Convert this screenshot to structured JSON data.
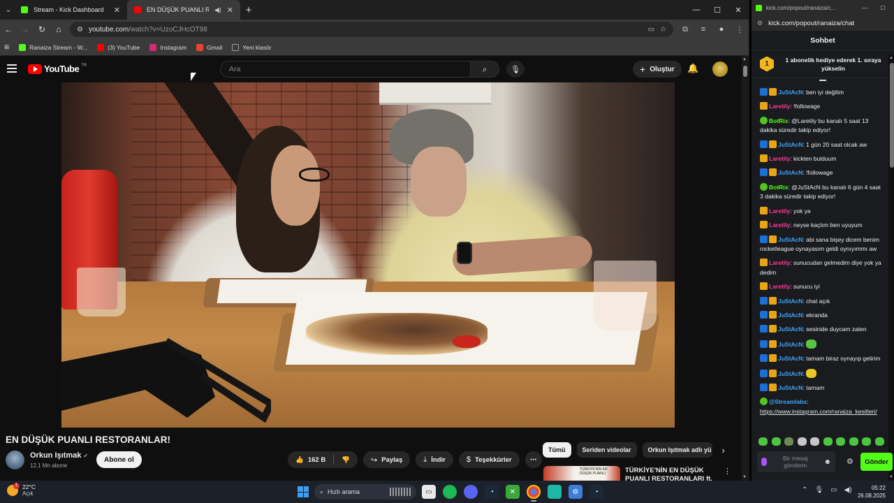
{
  "browser": {
    "tabs": [
      {
        "title": "Stream - Kick Dashboard",
        "favicon_color": "#53fc18"
      },
      {
        "title": "EN DÜŞÜK PUANLI RESTORAN",
        "favicon_color": "#ff0000"
      }
    ],
    "url_host": "youtube.com",
    "url_path": "/watch?v=UzoCJHcOT98",
    "bookmarks": [
      {
        "label": "Ranaiza Stream - W...",
        "color": "#53fc18"
      },
      {
        "label": "(3) YouTube",
        "color": "#ff0000"
      },
      {
        "label": "Instagram",
        "color": "#d62976"
      },
      {
        "label": "Gmail",
        "color": "#ea4335"
      },
      {
        "label": "Yeni klasör",
        "color": "#9aa0a6"
      }
    ]
  },
  "youtube": {
    "logo_text": "YouTube",
    "logo_tr": "TR",
    "search_placeholder": "Ara",
    "create_label": "Oluştur",
    "video_title": "EN DÜŞÜK PUANLI RESTORANLAR!",
    "channel_name": "Orkun Işıtmak",
    "channel_subs": "12,1 Mn abone",
    "subscribe_label": "Abone ol",
    "likes": "162 B",
    "share_label": "Paylaş",
    "download_label": "İndir",
    "thanks_label": "Teşekkürler",
    "chips": [
      "Tümü",
      "Seriden videolar",
      "Orkun Işıtmak adlı yü"
    ],
    "rec_title": "TÜRKİYE'NİN EN DÜŞÜK PUANLI RESTORANLARI ft.",
    "rec_thumb_text": "TÜRKİYE'NİN EN DÜŞÜK PUANLI"
  },
  "chat": {
    "window_url_short": "kick.com/popout/ranaiza/c...",
    "url": "kick.com/popout/ranaiza/chat",
    "header": "Sohbet",
    "pinned_rank": "1",
    "pinned_text": "1 abonelik hediye ederek 1. sıraya yükselin",
    "messages": [
      {
        "user": "JuStAcN",
        "color": "#3ea6ff",
        "badges": [
          "vip",
          "sub"
        ],
        "text": "ben iyi değilim"
      },
      {
        "user": "Laretily",
        "color": "#ff3b9a",
        "badges": [
          "sub"
        ],
        "text": "!followage"
      },
      {
        "user": "BotRix",
        "color": "#53fc18",
        "badges": [
          "bot"
        ],
        "text": "@Laretily bu kanalı 5 saat 13 dakika süredir takip ediyor!"
      },
      {
        "user": "JuStAcN",
        "color": "#3ea6ff",
        "badges": [
          "vip",
          "sub"
        ],
        "text": "1 gün 20 saat olcak aw"
      },
      {
        "user": "Laretily",
        "color": "#ff3b9a",
        "badges": [
          "sub"
        ],
        "text": "kickten bulduum"
      },
      {
        "user": "JuStAcN",
        "color": "#3ea6ff",
        "badges": [
          "vip",
          "sub"
        ],
        "text": "!followage"
      },
      {
        "user": "BotRix",
        "color": "#53fc18",
        "badges": [
          "bot"
        ],
        "text": "@JuStAcN bu kanalı 6 gün 4 saat 3 dakika süredir takip ediyor!"
      },
      {
        "user": "Laretily",
        "color": "#ff3b9a",
        "badges": [
          "sub"
        ],
        "text": "yok ya"
      },
      {
        "user": "Laretily",
        "color": "#ff3b9a",
        "badges": [
          "sub"
        ],
        "text": "neyse kaçtım ben uyuyum"
      },
      {
        "user": "JuStAcN",
        "color": "#3ea6ff",
        "badges": [
          "vip",
          "sub"
        ],
        "text": "abi sana bişey dicem benim rocketleague oynayasım geldi oynıyımmı aw"
      },
      {
        "user": "Laretily",
        "color": "#ff3b9a",
        "badges": [
          "sub"
        ],
        "text": "sunucudan gelmedim diye yok ya dedim"
      },
      {
        "user": "Laretily",
        "color": "#ff3b9a",
        "badges": [
          "sub"
        ],
        "text": "sunucu iyi"
      },
      {
        "user": "JuStAcN",
        "color": "#3ea6ff",
        "badges": [
          "vip",
          "sub"
        ],
        "text": "chat açık"
      },
      {
        "user": "JuStAcN",
        "color": "#3ea6ff",
        "badges": [
          "vip",
          "sub"
        ],
        "text": "ekranda"
      },
      {
        "user": "JuStAcN",
        "color": "#3ea6ff",
        "badges": [
          "vip",
          "sub"
        ],
        "text": "sesinide duycam zaten"
      },
      {
        "user": "JuStAcN",
        "color": "#3ea6ff",
        "badges": [
          "vip",
          "sub"
        ],
        "text": "",
        "emote": "green"
      },
      {
        "user": "JuStAcN",
        "color": "#3ea6ff",
        "badges": [
          "vip",
          "sub"
        ],
        "text": "tamam biraz oynayıp gelirim"
      },
      {
        "user": "JuStAcN",
        "color": "#3ea6ff",
        "badges": [
          "vip",
          "sub"
        ],
        "text": "",
        "emote": "yellow"
      },
      {
        "user": "JuStAcN",
        "color": "#3ea6ff",
        "badges": [
          "vip",
          "sub"
        ],
        "text": "tamam"
      },
      {
        "user": "@Streamlabs",
        "color": "#3ea6ff",
        "badges": [
          "bot"
        ],
        "text": "",
        "link": "https://www.instagram.com/ranaiza_kesitleri/"
      }
    ],
    "input_placeholder": "Bir mesaj gönderin",
    "send_label": "Gönder"
  },
  "taskbar": {
    "temp": "22°C",
    "condition": "Açık",
    "weather_badge": "1",
    "search_label": "Hızlı arama",
    "time": "05:22",
    "date": "26.08.2025"
  }
}
